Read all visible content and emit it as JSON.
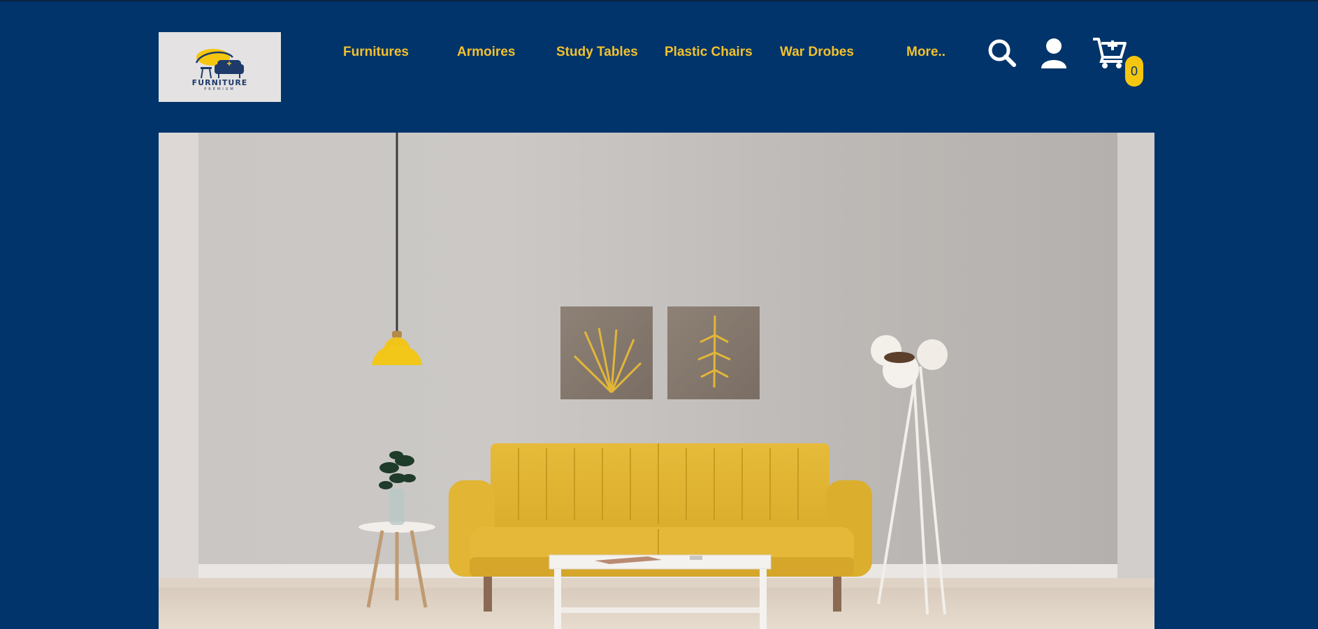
{
  "brand": {
    "name": "FURNITURE",
    "tagline": "PREMIUM"
  },
  "nav": {
    "items": [
      {
        "label": "Furnitures"
      },
      {
        "label": "Armoires"
      },
      {
        "label": "Study Tables"
      },
      {
        "label": "Plastic Chairs"
      },
      {
        "label": "War Drobes"
      },
      {
        "label": "More.."
      }
    ]
  },
  "actions": {
    "search_icon": "search-icon",
    "user_icon": "user-icon",
    "cart_icon": "cart-icon",
    "cart_count": "0"
  },
  "colors": {
    "background": "#00346a",
    "accent": "#f2c12e",
    "badge": "#f5c60f",
    "logo_bg": "#e4e2e2"
  },
  "hero": {
    "image": "living-room-yellow-sofa-photo"
  }
}
